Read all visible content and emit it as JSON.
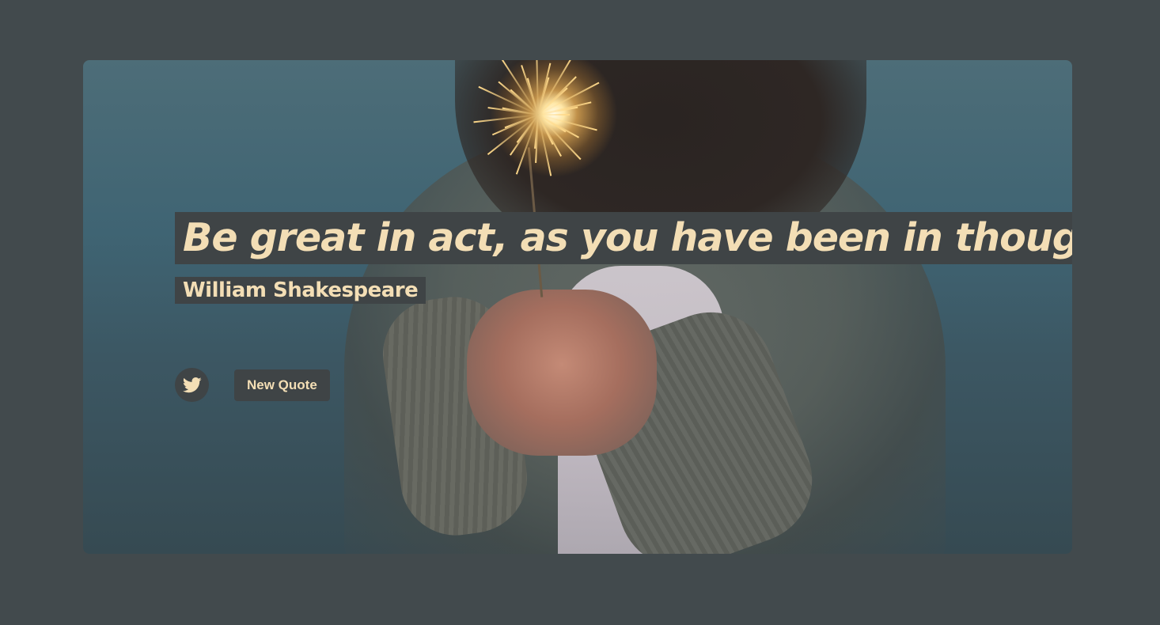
{
  "quote": {
    "text": "Be great in act, as you have been in thought.",
    "author": "William Shakespeare"
  },
  "actions": {
    "tweet_icon": "twitter-icon",
    "new_quote_label": "New Quote"
  },
  "colors": {
    "page_background": "#424a4d",
    "text_accent": "#f3deb5",
    "label_background": "#3f4446"
  }
}
